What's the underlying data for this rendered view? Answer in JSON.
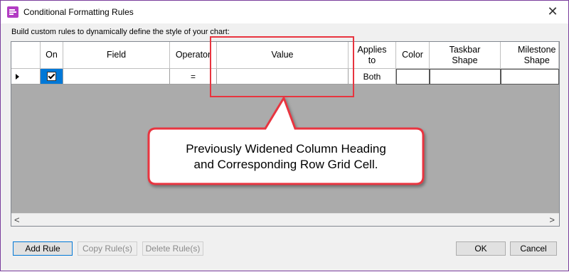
{
  "window": {
    "title": "Conditional Formatting Rules",
    "close_glyph": "✕",
    "icon": "app-icon"
  },
  "instructions": "Build custom rules to dynamically define the style of your chart:",
  "grid": {
    "columns": {
      "on": "On",
      "field": "Field",
      "operator": "Operator",
      "value": "Value",
      "applies_line1": "Applies",
      "applies_line2": "to",
      "color": "Color",
      "taskbar_line1": "Taskbar",
      "taskbar_line2": "Shape",
      "milestone_line1": "Milestone",
      "milestone_line2": "Shape"
    },
    "row": {
      "on_checked": true,
      "field": "",
      "operator": "=",
      "value": "",
      "applies": "Both",
      "color": "",
      "taskbar": "",
      "milestone": ""
    },
    "scroll_left": "<",
    "scroll_right": ">"
  },
  "callout": {
    "line1": "Previously Widened Column Heading",
    "line2": "and Corresponding Row Grid Cell."
  },
  "buttons": {
    "add_rule": "Add Rule",
    "copy_rule": "Copy Rule(s)",
    "delete_rule": "Delete Rule(s)",
    "ok": "OK",
    "cancel": "Cancel"
  },
  "colors": {
    "highlight": "#e8343f",
    "selection": "#0078d7",
    "grid_empty": "#ababab"
  }
}
